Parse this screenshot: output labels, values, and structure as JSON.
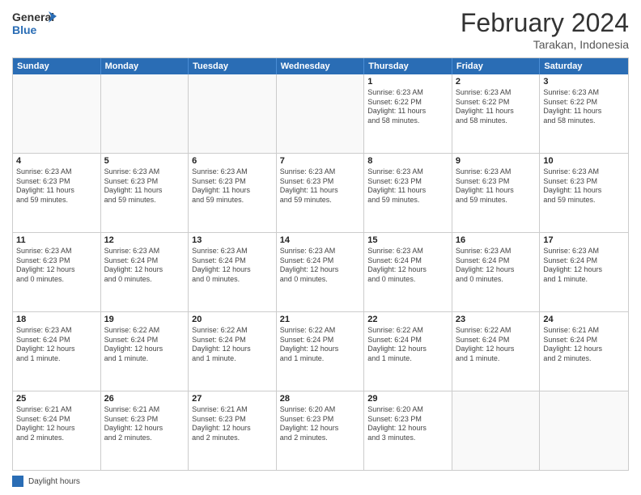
{
  "logo": {
    "line1": "General",
    "line2": "Blue"
  },
  "title": "February 2024",
  "subtitle": "Tarakan, Indonesia",
  "dayHeaders": [
    "Sunday",
    "Monday",
    "Tuesday",
    "Wednesday",
    "Thursday",
    "Friday",
    "Saturday"
  ],
  "weeks": [
    [
      {
        "num": "",
        "empty": true
      },
      {
        "num": "",
        "empty": true
      },
      {
        "num": "",
        "empty": true
      },
      {
        "num": "",
        "empty": true
      },
      {
        "num": "1",
        "info": "Sunrise: 6:23 AM\nSunset: 6:22 PM\nDaylight: 11 hours\nand 58 minutes."
      },
      {
        "num": "2",
        "info": "Sunrise: 6:23 AM\nSunset: 6:22 PM\nDaylight: 11 hours\nand 58 minutes."
      },
      {
        "num": "3",
        "info": "Sunrise: 6:23 AM\nSunset: 6:22 PM\nDaylight: 11 hours\nand 58 minutes."
      }
    ],
    [
      {
        "num": "4",
        "info": "Sunrise: 6:23 AM\nSunset: 6:23 PM\nDaylight: 11 hours\nand 59 minutes."
      },
      {
        "num": "5",
        "info": "Sunrise: 6:23 AM\nSunset: 6:23 PM\nDaylight: 11 hours\nand 59 minutes."
      },
      {
        "num": "6",
        "info": "Sunrise: 6:23 AM\nSunset: 6:23 PM\nDaylight: 11 hours\nand 59 minutes."
      },
      {
        "num": "7",
        "info": "Sunrise: 6:23 AM\nSunset: 6:23 PM\nDaylight: 11 hours\nand 59 minutes."
      },
      {
        "num": "8",
        "info": "Sunrise: 6:23 AM\nSunset: 6:23 PM\nDaylight: 11 hours\nand 59 minutes."
      },
      {
        "num": "9",
        "info": "Sunrise: 6:23 AM\nSunset: 6:23 PM\nDaylight: 11 hours\nand 59 minutes."
      },
      {
        "num": "10",
        "info": "Sunrise: 6:23 AM\nSunset: 6:23 PM\nDaylight: 11 hours\nand 59 minutes."
      }
    ],
    [
      {
        "num": "11",
        "info": "Sunrise: 6:23 AM\nSunset: 6:23 PM\nDaylight: 12 hours\nand 0 minutes."
      },
      {
        "num": "12",
        "info": "Sunrise: 6:23 AM\nSunset: 6:24 PM\nDaylight: 12 hours\nand 0 minutes."
      },
      {
        "num": "13",
        "info": "Sunrise: 6:23 AM\nSunset: 6:24 PM\nDaylight: 12 hours\nand 0 minutes."
      },
      {
        "num": "14",
        "info": "Sunrise: 6:23 AM\nSunset: 6:24 PM\nDaylight: 12 hours\nand 0 minutes."
      },
      {
        "num": "15",
        "info": "Sunrise: 6:23 AM\nSunset: 6:24 PM\nDaylight: 12 hours\nand 0 minutes."
      },
      {
        "num": "16",
        "info": "Sunrise: 6:23 AM\nSunset: 6:24 PM\nDaylight: 12 hours\nand 0 minutes."
      },
      {
        "num": "17",
        "info": "Sunrise: 6:23 AM\nSunset: 6:24 PM\nDaylight: 12 hours\nand 1 minute."
      }
    ],
    [
      {
        "num": "18",
        "info": "Sunrise: 6:23 AM\nSunset: 6:24 PM\nDaylight: 12 hours\nand 1 minute."
      },
      {
        "num": "19",
        "info": "Sunrise: 6:22 AM\nSunset: 6:24 PM\nDaylight: 12 hours\nand 1 minute."
      },
      {
        "num": "20",
        "info": "Sunrise: 6:22 AM\nSunset: 6:24 PM\nDaylight: 12 hours\nand 1 minute."
      },
      {
        "num": "21",
        "info": "Sunrise: 6:22 AM\nSunset: 6:24 PM\nDaylight: 12 hours\nand 1 minute."
      },
      {
        "num": "22",
        "info": "Sunrise: 6:22 AM\nSunset: 6:24 PM\nDaylight: 12 hours\nand 1 minute."
      },
      {
        "num": "23",
        "info": "Sunrise: 6:22 AM\nSunset: 6:24 PM\nDaylight: 12 hours\nand 1 minute."
      },
      {
        "num": "24",
        "info": "Sunrise: 6:21 AM\nSunset: 6:24 PM\nDaylight: 12 hours\nand 2 minutes."
      }
    ],
    [
      {
        "num": "25",
        "info": "Sunrise: 6:21 AM\nSunset: 6:24 PM\nDaylight: 12 hours\nand 2 minutes."
      },
      {
        "num": "26",
        "info": "Sunrise: 6:21 AM\nSunset: 6:23 PM\nDaylight: 12 hours\nand 2 minutes."
      },
      {
        "num": "27",
        "info": "Sunrise: 6:21 AM\nSunset: 6:23 PM\nDaylight: 12 hours\nand 2 minutes."
      },
      {
        "num": "28",
        "info": "Sunrise: 6:20 AM\nSunset: 6:23 PM\nDaylight: 12 hours\nand 2 minutes."
      },
      {
        "num": "29",
        "info": "Sunrise: 6:20 AM\nSunset: 6:23 PM\nDaylight: 12 hours\nand 3 minutes."
      },
      {
        "num": "",
        "empty": true
      },
      {
        "num": "",
        "empty": true
      }
    ]
  ],
  "legend": {
    "label": "Daylight hours"
  }
}
